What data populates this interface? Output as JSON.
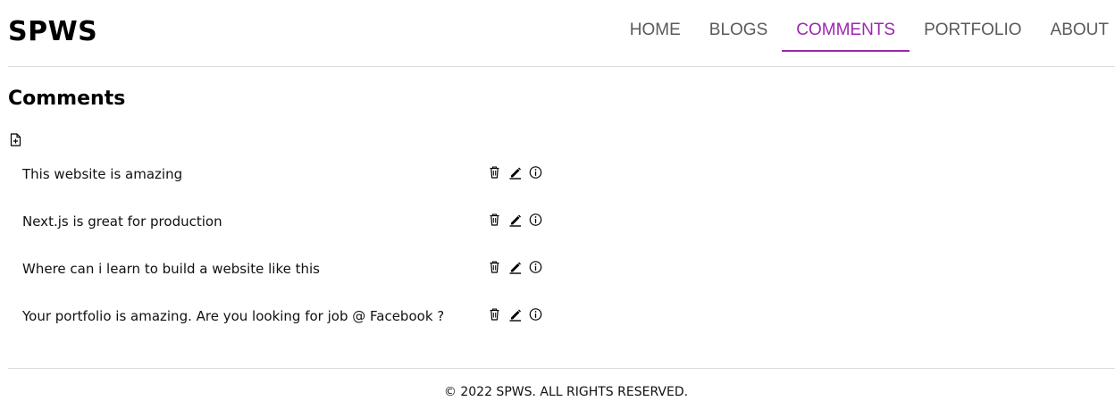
{
  "header": {
    "brand": "SPWS",
    "nav": [
      {
        "label": "HOME",
        "active": false
      },
      {
        "label": "BLOGS",
        "active": false
      },
      {
        "label": "COMMENTS",
        "active": true
      },
      {
        "label": "PORTFOLIO",
        "active": false
      },
      {
        "label": "ABOUT",
        "active": false
      }
    ]
  },
  "main": {
    "title": "Comments",
    "add_icon": "file-plus-icon",
    "comments": [
      {
        "text": "This website is amazing"
      },
      {
        "text": "Next.js is great for production"
      },
      {
        "text": "Where can i learn to build a website like this"
      },
      {
        "text": "Your portfolio is amazing. Are you looking for job @ Facebook ?"
      }
    ],
    "row_icons": [
      "trash-icon",
      "pencil-icon",
      "info-icon"
    ]
  },
  "footer": {
    "copyright": "© 2022 SPWS. ALL RIGHTS RESERVED."
  },
  "colors": {
    "accent": "#9c27b0",
    "nav_text": "#5a5a5a",
    "divider": "#dcdcdc"
  }
}
